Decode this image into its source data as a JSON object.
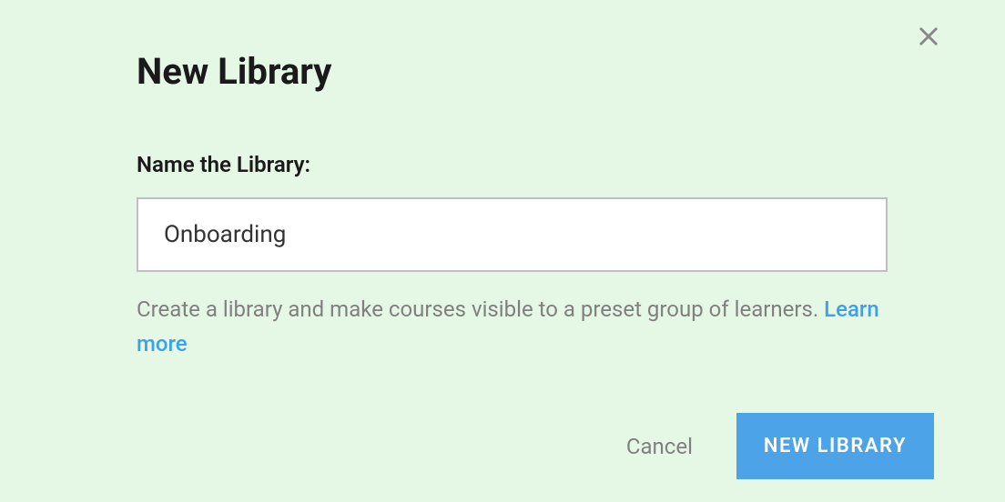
{
  "dialog": {
    "title": "New Library",
    "close_icon": "close-icon"
  },
  "form": {
    "label": "Name the Library:",
    "input_value": "Onboarding",
    "helper_text": "Create a library and make courses visible to a preset group of learners. ",
    "learn_more_label": "Learn more"
  },
  "buttons": {
    "cancel_label": "Cancel",
    "primary_label": "NEW LIBRARY"
  }
}
